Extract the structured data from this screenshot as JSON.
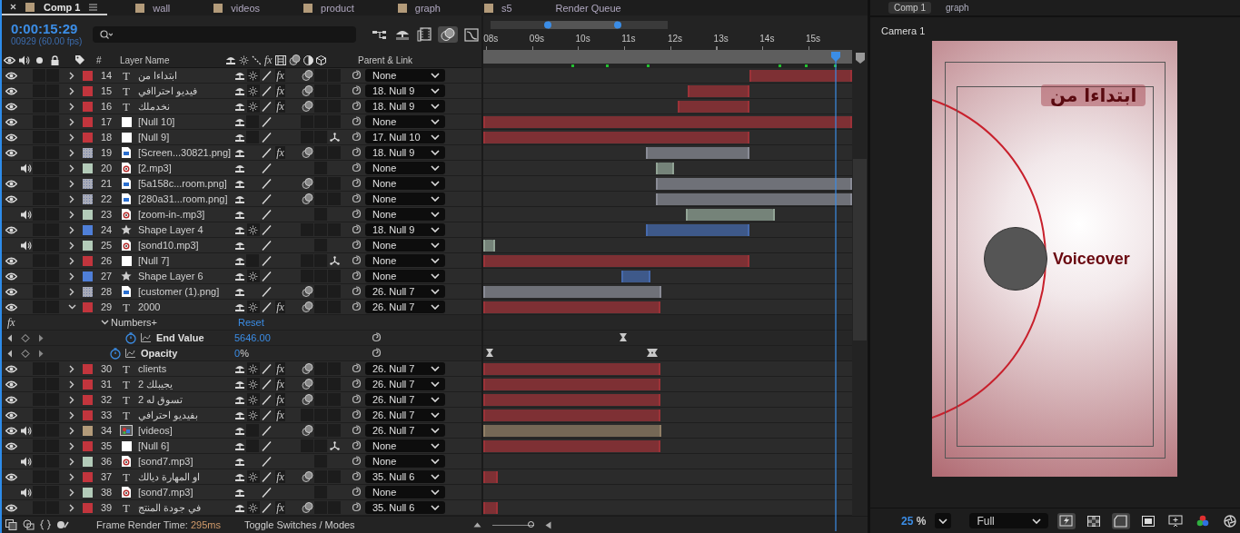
{
  "tabs": [
    {
      "label": "Comp 1",
      "kind": "comp",
      "selected": true
    },
    {
      "label": "wall",
      "kind": "comp",
      "selected": false
    },
    {
      "label": "videos",
      "kind": "comp",
      "selected": false
    },
    {
      "label": "product",
      "kind": "comp",
      "selected": false
    },
    {
      "label": "graph",
      "kind": "comp",
      "selected": false
    },
    {
      "label": "s5",
      "kind": "comp",
      "selected": false
    },
    {
      "label": "Render Queue",
      "kind": "panel",
      "selected": false
    }
  ],
  "timecode": "0:00:15:29",
  "frame_info": "00929 (60.00 fps)",
  "columns": {
    "number": "#",
    "name": "Layer Name",
    "fx": "fx",
    "parent": "Parent & Link"
  },
  "layers": [
    {
      "number": "14",
      "kind": "text",
      "glyph": "T",
      "name": "ابتداءا من",
      "color": "#c2353d",
      "visible": true,
      "audio": false,
      "solo": false,
      "locked": false,
      "expanded": false,
      "fx": "fx",
      "effects_enabled": true,
      "collapse": true,
      "motion_blur": true,
      "three_d": false,
      "parent": "None",
      "bar": {
        "start": {
          "level": 0.722
        },
        "end": {
          "level": 1
        }
      }
    },
    {
      "number": "15",
      "kind": "text",
      "glyph": "T",
      "name": "فيديو احتراافي",
      "color": "#c2353d",
      "visible": true,
      "audio": false,
      "solo": false,
      "locked": false,
      "expanded": false,
      "fx": "fx",
      "effects_enabled": true,
      "collapse": true,
      "motion_blur": true,
      "three_d": false,
      "parent": "18. Null 9",
      "bar": {
        "start": {
          "level": 0.554
        },
        "end": {
          "level": 0.722
        }
      }
    },
    {
      "number": "16",
      "kind": "text",
      "glyph": "T",
      "name": "نخدملك",
      "color": "#c2353d",
      "visible": true,
      "audio": false,
      "solo": false,
      "locked": false,
      "expanded": false,
      "fx": "fx",
      "effects_enabled": true,
      "collapse": true,
      "motion_blur": true,
      "three_d": false,
      "parent": "18. Null 9",
      "bar": {
        "start": {
          "level": 0.527
        },
        "end": {
          "level": 0.722
        }
      }
    },
    {
      "number": "17",
      "kind": "null",
      "name": "[Null 10]",
      "color": "#c2353d",
      "visible": true,
      "audio": false,
      "solo": false,
      "locked": false,
      "expanded": false,
      "collapse": false,
      "motion_blur": false,
      "three_d": false,
      "parent": "None",
      "bar": {
        "start": {
          "level": 0
        },
        "end": {
          "level": 1
        }
      }
    },
    {
      "number": "18",
      "kind": "null",
      "name": "[Null 9]",
      "color": "#c2353d",
      "visible": true,
      "audio": false,
      "solo": false,
      "locked": false,
      "expanded": false,
      "collapse": false,
      "motion_blur": false,
      "three_d": true,
      "parent": "17. Null 10",
      "bar": {
        "start": {
          "level": 0
        },
        "end": {
          "level": 0.722
        }
      }
    },
    {
      "number": "19",
      "kind": "image",
      "name": "[Screen...30821.png]",
      "color": "#a8abb8",
      "visible": true,
      "audio": false,
      "solo": false,
      "locked": false,
      "expanded": false,
      "fx": "fx",
      "effects_enabled": true,
      "collapse": false,
      "motion_blur": true,
      "three_d": false,
      "parent": "18. Null 9",
      "bar": {
        "start": {
          "level": 0.441
        },
        "end": {
          "level": 0.722
        }
      }
    },
    {
      "number": "20",
      "kind": "audio",
      "name": "[2.mp3]",
      "color": "#b3cbb9",
      "visible": false,
      "audio": true,
      "solo": false,
      "locked": false,
      "expanded": false,
      "collapse": false,
      "motion_blur": false,
      "three_d": false,
      "parent": "None",
      "bar": {
        "start": {
          "level": 0.468
        },
        "end": {
          "level": 0.517
        }
      }
    },
    {
      "number": "21",
      "kind": "image",
      "name": "[5a158c...room.png]",
      "color": "#a8abb8",
      "visible": true,
      "audio": false,
      "solo": false,
      "locked": false,
      "expanded": false,
      "collapse": false,
      "motion_blur": true,
      "three_d": false,
      "parent": "None",
      "bar": {
        "start": {
          "level": 0.468
        },
        "end": {
          "level": 1
        }
      }
    },
    {
      "number": "22",
      "kind": "image",
      "name": "[280a31...room.png]",
      "color": "#a8abb8",
      "visible": true,
      "audio": false,
      "solo": false,
      "locked": false,
      "expanded": false,
      "collapse": false,
      "motion_blur": true,
      "three_d": false,
      "parent": "None",
      "bar": {
        "start": {
          "level": 0.468
        },
        "end": {
          "level": 1
        }
      }
    },
    {
      "number": "23",
      "kind": "audio",
      "name": "[zoom-in-.mp3]",
      "color": "#b3cbb9",
      "visible": false,
      "audio": true,
      "solo": false,
      "locked": false,
      "expanded": false,
      "collapse": false,
      "motion_blur": false,
      "three_d": false,
      "parent": "None",
      "bar": {
        "start": {
          "level": 0.549
        },
        "end": {
          "level": 0.79
        }
      }
    },
    {
      "number": "24",
      "kind": "shape",
      "name": "Shape Layer 4",
      "color": "#4f7fd8",
      "visible": true,
      "audio": false,
      "solo": false,
      "locked": false,
      "expanded": false,
      "collapse": true,
      "motion_blur": false,
      "three_d": false,
      "parent": "18. Null 9",
      "bar": {
        "start": {
          "level": 0.441
        },
        "end": {
          "level": 0.722
        }
      }
    },
    {
      "number": "25",
      "kind": "audio",
      "name": "[sond10.mp3]",
      "color": "#b3cbb9",
      "visible": false,
      "audio": true,
      "solo": false,
      "locked": false,
      "expanded": false,
      "collapse": false,
      "motion_blur": false,
      "three_d": false,
      "parent": "None",
      "bar": {
        "start": {
          "level": 0
        },
        "end": {
          "level": 0.032
        }
      }
    },
    {
      "number": "26",
      "kind": "null",
      "name": "[Null 7]",
      "color": "#c2353d",
      "visible": true,
      "audio": false,
      "solo": false,
      "locked": false,
      "expanded": false,
      "collapse": false,
      "motion_blur": false,
      "three_d": true,
      "parent": "None",
      "bar": {
        "start": {
          "level": 0
        },
        "end": {
          "level": 0.722
        }
      }
    },
    {
      "number": "27",
      "kind": "shape",
      "name": "Shape Layer 6",
      "color": "#4f7fd8",
      "visible": true,
      "audio": false,
      "solo": false,
      "locked": false,
      "expanded": false,
      "collapse": true,
      "motion_blur": false,
      "three_d": false,
      "parent": "None",
      "bar": {
        "start": {
          "level": 0.375
        },
        "end": {
          "level": 0.453
        }
      }
    },
    {
      "number": "28",
      "kind": "image",
      "name": "[customer (1).png]",
      "color": "#a8abb8",
      "visible": true,
      "audio": false,
      "solo": false,
      "locked": false,
      "expanded": false,
      "collapse": false,
      "motion_blur": true,
      "three_d": false,
      "parent": "26. Null 7",
      "bar": {
        "start": {
          "level": 0
        },
        "end": {
          "level": 0.483
        }
      }
    },
    {
      "number": "29",
      "kind": "text",
      "glyph": "T",
      "name": "2000",
      "color": "#c2353d",
      "visible": true,
      "audio": false,
      "solo": false,
      "locked": false,
      "expanded": true,
      "fx": "fx",
      "effects_enabled": true,
      "collapse": true,
      "motion_blur": true,
      "three_d": false,
      "parent": "26. Null 7",
      "bar": {
        "start": {
          "level": 0
        },
        "end": {
          "level": 0.481
        }
      },
      "children": [
        {
          "kind": "effect",
          "icon": "fx",
          "name": "Numbers+",
          "action": "Reset",
          "expanded": true,
          "children": [
            {
              "kind": "property",
              "name": "End Value",
              "value": "5646.00",
              "animated": true,
              "keyframes": [
                {
                  "level": 0.38
                }
              ]
            }
          ]
        },
        {
          "kind": "property",
          "name": "Opacity",
          "value": "0",
          "unit": "%",
          "animated": true,
          "keyframes": [
            {
              "level": 0.017
            },
            {
              "level": 0.452
            },
            {
              "level": 0.464
            }
          ]
        }
      ]
    },
    {
      "number": "30",
      "kind": "text",
      "glyph": "T",
      "name": "clients",
      "color": "#c2353d",
      "visible": true,
      "audio": false,
      "solo": false,
      "locked": false,
      "expanded": false,
      "fx": "fx",
      "effects_enabled": true,
      "collapse": true,
      "motion_blur": true,
      "three_d": false,
      "parent": "26. Null 7",
      "bar": {
        "start": {
          "level": 0
        },
        "end": {
          "level": 0.481
        }
      }
    },
    {
      "number": "31",
      "kind": "text",
      "glyph": "T",
      "name": "يجيبلك 2",
      "color": "#c2353d",
      "visible": true,
      "audio": false,
      "solo": false,
      "locked": false,
      "expanded": false,
      "fx": "fx",
      "effects_enabled": true,
      "collapse": true,
      "motion_blur": true,
      "three_d": false,
      "parent": "26. Null 7",
      "bar": {
        "start": {
          "level": 0
        },
        "end": {
          "level": 0.481
        }
      }
    },
    {
      "number": "32",
      "kind": "text",
      "glyph": "T",
      "name": "تسوق له 2",
      "color": "#c2353d",
      "visible": true,
      "audio": false,
      "solo": false,
      "locked": false,
      "expanded": false,
      "fx": "fx",
      "effects_enabled": true,
      "collapse": true,
      "motion_blur": true,
      "three_d": false,
      "parent": "26. Null 7",
      "bar": {
        "start": {
          "level": 0
        },
        "end": {
          "level": 0.481
        }
      }
    },
    {
      "number": "33",
      "kind": "text",
      "glyph": "T",
      "name": "بفيديو احترافي",
      "color": "#c2353d",
      "visible": true,
      "audio": false,
      "solo": false,
      "locked": false,
      "expanded": false,
      "fx": "fx",
      "effects_enabled": true,
      "collapse": true,
      "motion_blur": false,
      "three_d": false,
      "parent": "26. Null 7",
      "bar": {
        "start": {
          "level": 0
        },
        "end": {
          "level": 0.481
        }
      }
    },
    {
      "number": "34",
      "kind": "precomp",
      "name": "[videos]",
      "color": "#b39b7a",
      "visible": true,
      "audio": true,
      "solo": false,
      "locked": false,
      "expanded": false,
      "collapse": false,
      "motion_blur": true,
      "three_d": false,
      "parent": "26. Null 7",
      "bar": {
        "start": {
          "level": 0
        },
        "end": {
          "level": 0.483
        }
      }
    },
    {
      "number": "35",
      "kind": "null",
      "name": "[Null 6]",
      "color": "#c2353d",
      "visible": true,
      "audio": false,
      "solo": false,
      "locked": false,
      "expanded": false,
      "collapse": false,
      "motion_blur": false,
      "three_d": true,
      "parent": "None",
      "bar": {
        "start": {
          "level": 0
        },
        "end": {
          "level": 0.481
        }
      }
    },
    {
      "number": "36",
      "kind": "audio",
      "name": "[sond7.mp3]",
      "color": "#b3cbb9",
      "visible": false,
      "audio": true,
      "solo": false,
      "locked": false,
      "expanded": false,
      "collapse": false,
      "motion_blur": false,
      "three_d": false,
      "parent": "None"
    },
    {
      "number": "37",
      "kind": "text",
      "glyph": "T",
      "name": "او المهارة ديالك",
      "color": "#c2353d",
      "visible": true,
      "audio": false,
      "solo": false,
      "locked": false,
      "expanded": false,
      "fx": "fx",
      "effects_enabled": true,
      "collapse": true,
      "motion_blur": true,
      "three_d": false,
      "parent": "35. Null 6",
      "bar": {
        "start": {
          "level": 0
        },
        "end": {
          "level": 0.04
        }
      }
    },
    {
      "number": "38",
      "kind": "audio",
      "name": "[sond7.mp3]",
      "color": "#b3cbb9",
      "visible": false,
      "audio": true,
      "solo": false,
      "locked": false,
      "expanded": false,
      "collapse": false,
      "motion_blur": false,
      "three_d": false,
      "parent": "None"
    },
    {
      "number": "39",
      "kind": "text",
      "glyph": "T",
      "name": "في جودة المنتج",
      "color": "#c2353d",
      "visible": true,
      "audio": false,
      "solo": false,
      "locked": false,
      "expanded": false,
      "fx": "fx",
      "effects_enabled": true,
      "collapse": true,
      "motion_blur": true,
      "three_d": false,
      "parent": "35. Null 6",
      "bar": {
        "start": {
          "level": 0
        },
        "end": {
          "level": 0.04
        }
      }
    }
  ],
  "timeline": {
    "ruler": [
      "08s",
      "09s",
      "10s",
      "11s",
      "12s",
      "13s",
      "14s",
      "15s"
    ],
    "markers": [
      {
        "level": 0.243
      },
      {
        "level": 0.335
      },
      {
        "level": 0.448
      },
      {
        "level": 0.805
      },
      {
        "level": 0.876
      },
      {
        "level": 0.955
      }
    ],
    "playhead": {
      "level": 0.956
    },
    "zoom_slider": {
      "level": 0.95
    }
  },
  "status_bar": {
    "render_label": "Frame Render Time:",
    "render_value": "295ms",
    "toggle": "Toggle Switches / Modes"
  },
  "viewer": {
    "tabs": [
      {
        "label": "Comp 1",
        "selected": true
      },
      {
        "label": "graph",
        "selected": false
      }
    ],
    "camera": "Camera 1",
    "title_text": "ابتداءا من",
    "caption_text": "Voiceover",
    "zoom_value": "25",
    "zoom_unit": "%",
    "resolution": "Full"
  }
}
